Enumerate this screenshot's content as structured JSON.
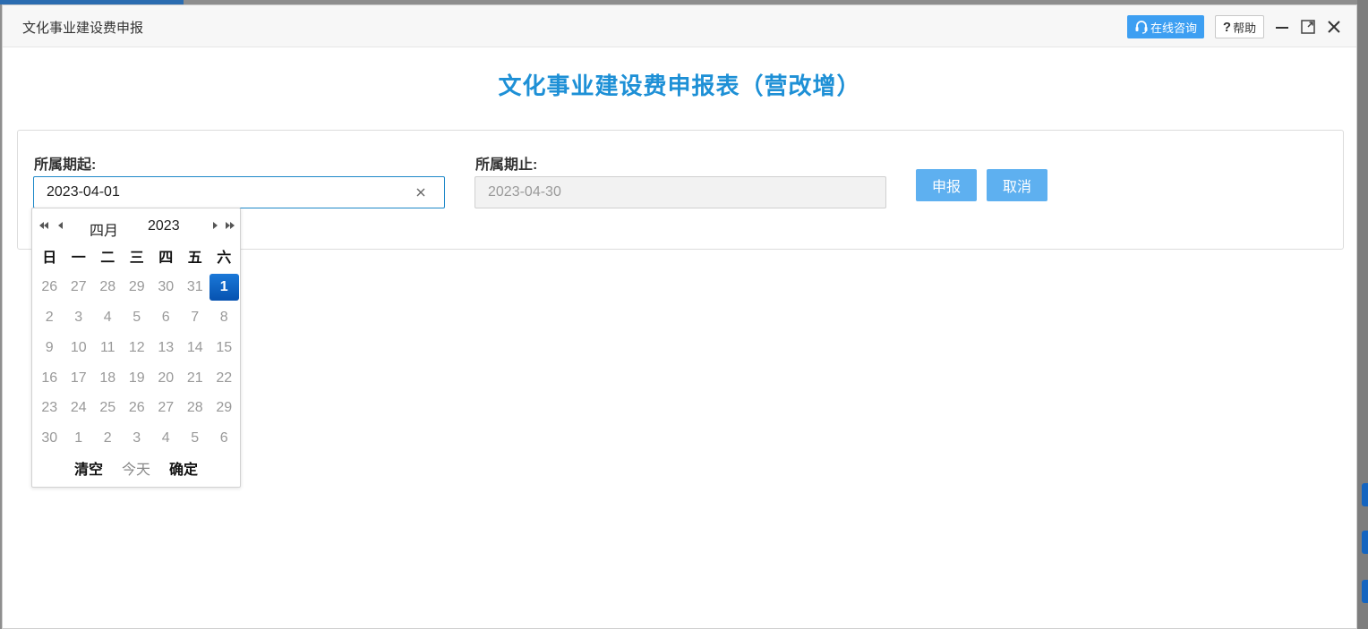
{
  "dialog": {
    "title": "文化事业建设费申报",
    "consult_label": "在线咨询",
    "help_label": "帮助",
    "help_mark": "?"
  },
  "form": {
    "title": "文化事业建设费申报表（营改增）",
    "start_label": "所属期起:",
    "start_value": "2023-04-01",
    "end_label": "所属期止:",
    "end_value": "2023-04-30",
    "submit_label": "申报",
    "cancel_label": "取消"
  },
  "calendar": {
    "month": "四月",
    "year": "2023",
    "weekdays": [
      "日",
      "一",
      "二",
      "三",
      "四",
      "五",
      "六"
    ],
    "weeks": [
      [
        "26",
        "27",
        "28",
        "29",
        "30",
        "31",
        "1"
      ],
      [
        "2",
        "3",
        "4",
        "5",
        "6",
        "7",
        "8"
      ],
      [
        "9",
        "10",
        "11",
        "12",
        "13",
        "14",
        "15"
      ],
      [
        "16",
        "17",
        "18",
        "19",
        "20",
        "21",
        "22"
      ],
      [
        "23",
        "24",
        "25",
        "26",
        "27",
        "28",
        "29"
      ],
      [
        "30",
        "1",
        "2",
        "3",
        "4",
        "5",
        "6"
      ]
    ],
    "selected": "1",
    "clear_label": "清空",
    "today_label": "今天",
    "confirm_label": "确定"
  },
  "colors": {
    "accent": "#3d9ff2",
    "title_blue": "#1e90d6",
    "selected_day": "#0b63c6",
    "button": "#5eb0f0"
  }
}
